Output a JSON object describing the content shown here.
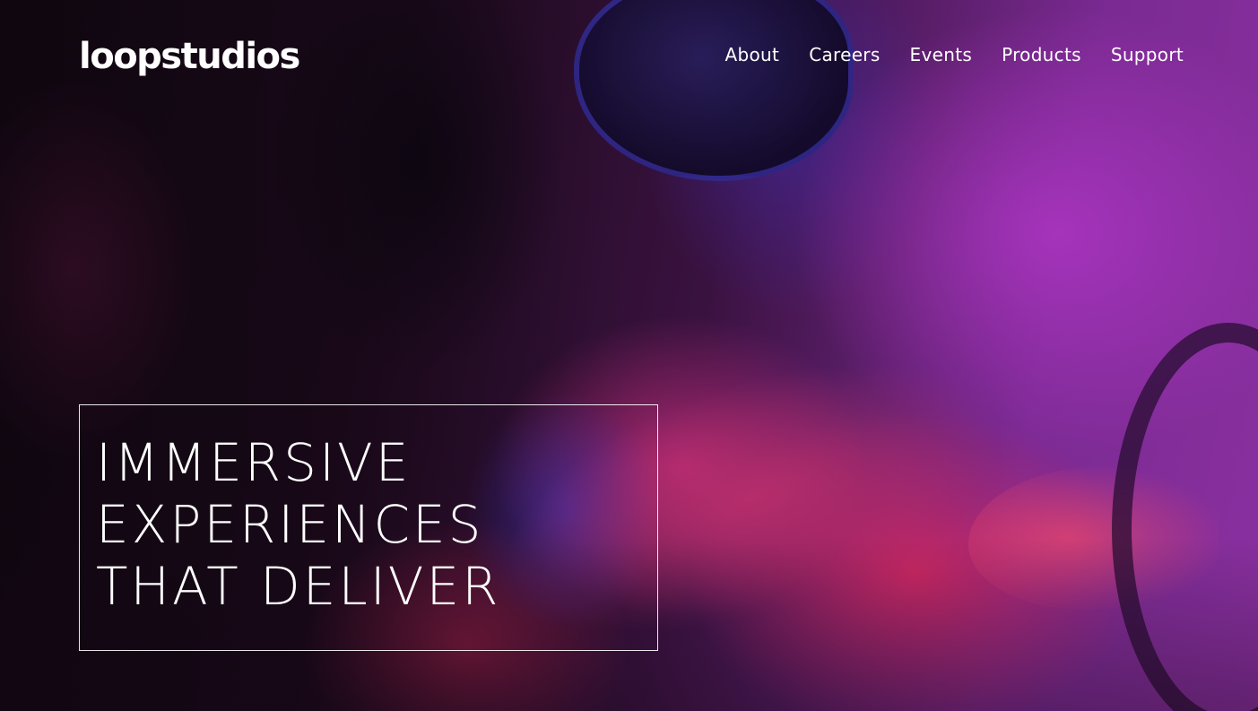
{
  "brand": {
    "logo_text": "loopstudios"
  },
  "nav": {
    "items": [
      {
        "label": "About"
      },
      {
        "label": "Careers"
      },
      {
        "label": "Events"
      },
      {
        "label": "Products"
      },
      {
        "label": "Support"
      }
    ]
  },
  "hero": {
    "headline_lines": [
      "IMMERSIVE",
      "EXPERIENCES",
      "THAT DELIVER"
    ]
  },
  "colors": {
    "text": "#ffffff",
    "accent_purple": "#8a30a0",
    "accent_magenta": "#d42860",
    "background_dark": "#150914"
  }
}
